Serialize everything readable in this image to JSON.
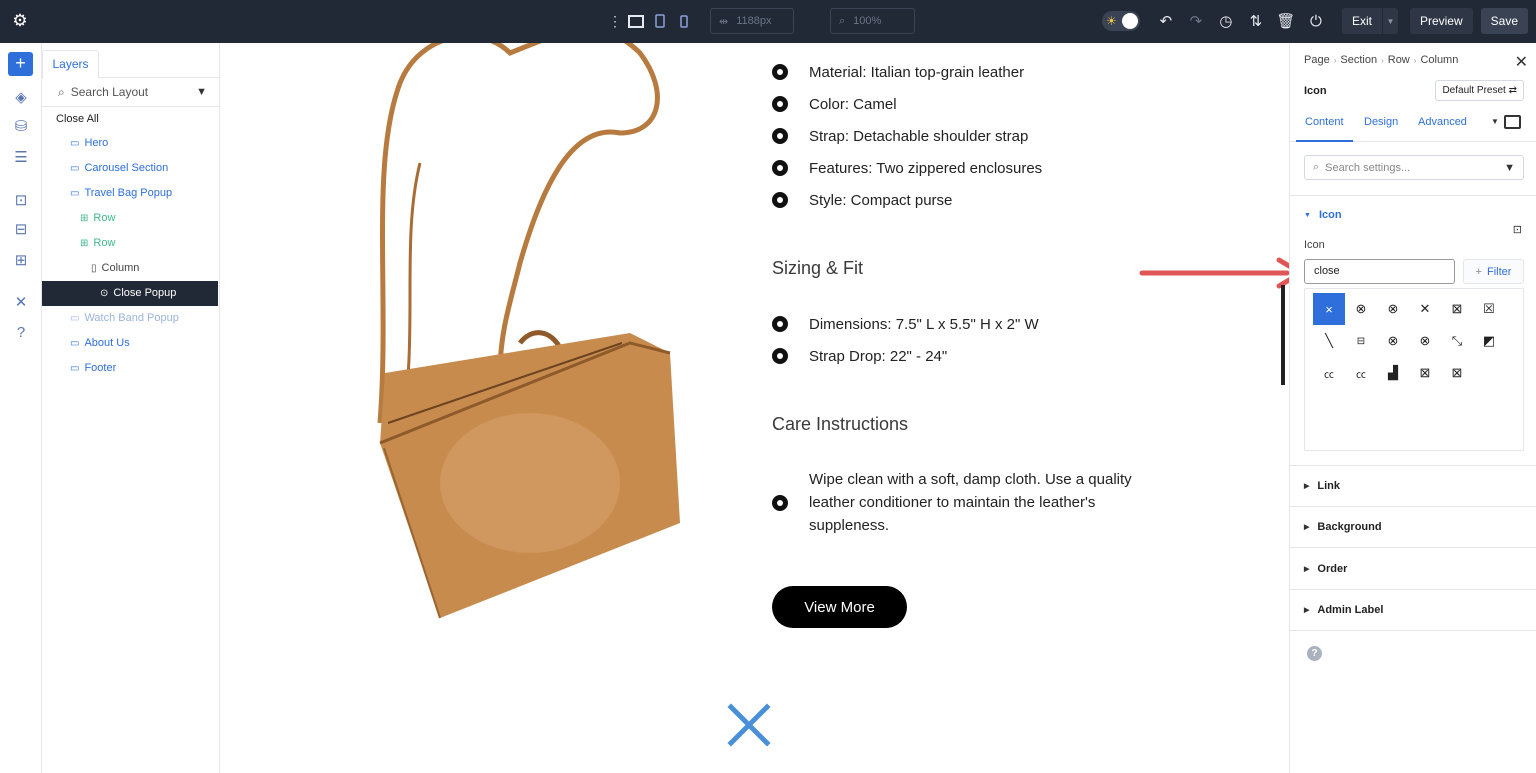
{
  "topbar": {
    "width_value": "1188px",
    "zoom_value": "100%",
    "exit_label": "Exit",
    "preview_label": "Preview",
    "save_label": "Save"
  },
  "layers_panel": {
    "tab_label": "Layers",
    "search_placeholder": "Search Layout",
    "close_all_label": "Close All",
    "items": [
      {
        "label": "Hero",
        "color": "#2e6fdb"
      },
      {
        "label": "Carousel Section",
        "color": "#2e6fdb"
      },
      {
        "label": "Travel Bag Popup",
        "color": "#2e6fdb"
      },
      {
        "label": "Row",
        "color": "#3fb98a"
      },
      {
        "label": "Row",
        "color": "#3fb98a"
      },
      {
        "label": "Column",
        "color": "#444444"
      },
      {
        "label": "Close Popup",
        "color": "#ffffff"
      },
      {
        "label": "Watch Band Popup",
        "color": "#9bb3dc"
      },
      {
        "label": "About Us",
        "color": "#2e6fdb"
      },
      {
        "label": "Footer",
        "color": "#2e6fdb"
      }
    ]
  },
  "canvas": {
    "features": [
      "Material: Italian top-grain leather",
      "Color: Camel",
      "Strap: Detachable shoulder strap",
      "Features: Two zippered enclosures",
      "Style: Compact purse"
    ],
    "sizing_heading": "Sizing & Fit",
    "sizing": [
      "Dimensions: 7.5\" L x 5.5\" H x 2\" W",
      "Strap Drop: 22\" - 24\""
    ],
    "care_heading": "Care Instructions",
    "care_text": "Wipe clean with a soft, damp cloth. Use a quality leather conditioner to maintain the leather's suppleness.",
    "button_label": "View More",
    "close_icon_color": "#4a90d9"
  },
  "settings_panel": {
    "breadcrumb": [
      "Page",
      "Section",
      "Row",
      "Column"
    ],
    "module_title": "Icon",
    "preset_label": "Default Preset",
    "tabs": [
      "Content",
      "Design",
      "Advanced"
    ],
    "search_placeholder": "Search settings...",
    "icon_group_label": "Icon",
    "icon_field_label": "Icon",
    "icon_search_value": "close",
    "filter_label": "Filter",
    "groups": [
      "Link",
      "Background",
      "Order",
      "Admin Label"
    ]
  },
  "colors": {
    "topbar_bg": "#222936",
    "accent": "#2e6fdb",
    "annotation_arrow": "#e05555"
  }
}
